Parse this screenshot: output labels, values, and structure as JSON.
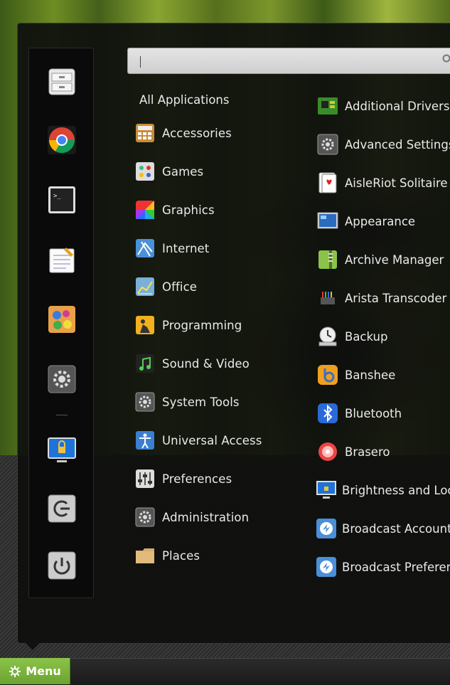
{
  "search": {
    "value": "",
    "placeholder": ""
  },
  "categories_header": "All Applications",
  "categories": [
    {
      "label": "Accessories",
      "icon": "accessories-icon"
    },
    {
      "label": "Games",
      "icon": "games-icon"
    },
    {
      "label": "Graphics",
      "icon": "graphics-icon"
    },
    {
      "label": "Internet",
      "icon": "internet-icon"
    },
    {
      "label": "Office",
      "icon": "office-icon"
    },
    {
      "label": "Programming",
      "icon": "programming-icon"
    },
    {
      "label": "Sound & Video",
      "icon": "sound-video-icon"
    },
    {
      "label": "System Tools",
      "icon": "system-tools-icon"
    },
    {
      "label": "Universal Access",
      "icon": "universal-access-icon"
    },
    {
      "label": "Preferences",
      "icon": "preferences-icon"
    },
    {
      "label": "Administration",
      "icon": "administration-icon"
    },
    {
      "label": "Places",
      "icon": "folder-icon"
    }
  ],
  "apps": [
    {
      "label": "Additional Drivers",
      "icon": "chip-icon"
    },
    {
      "label": "Advanced Settings",
      "icon": "settings-gear-icon"
    },
    {
      "label": "AisleRiot Solitaire",
      "icon": "playing-card-icon"
    },
    {
      "label": "Appearance",
      "icon": "appearance-icon"
    },
    {
      "label": "Archive Manager",
      "icon": "archive-icon"
    },
    {
      "label": "Arista Transcoder",
      "icon": "transcoder-icon"
    },
    {
      "label": "Backup",
      "icon": "backup-icon"
    },
    {
      "label": "Banshee",
      "icon": "banshee-icon"
    },
    {
      "label": "Bluetooth",
      "icon": "bluetooth-icon"
    },
    {
      "label": "Brasero",
      "icon": "brasero-icon"
    },
    {
      "label": "Brightness and Lock",
      "icon": "brightness-lock-icon"
    },
    {
      "label": "Broadcast Accounts",
      "icon": "broadcast-icon"
    },
    {
      "label": "Broadcast Preferences",
      "icon": "broadcast-icon"
    }
  ],
  "favorites": [
    {
      "name": "files-cabinet-icon"
    },
    {
      "name": "chrome-icon"
    },
    {
      "name": "terminal-icon"
    },
    {
      "name": "text-editor-icon"
    },
    {
      "name": "paint-icon"
    },
    {
      "name": "system-settings-icon"
    },
    {
      "name": "lock-screen-icon"
    },
    {
      "name": "logout-icon"
    },
    {
      "name": "power-icon"
    }
  ],
  "panel": {
    "menu_label": "Menu"
  },
  "colors": {
    "menu_green": "#7ab63f",
    "panel_bg": "#0e0f0d",
    "text": "#eaeaea"
  }
}
